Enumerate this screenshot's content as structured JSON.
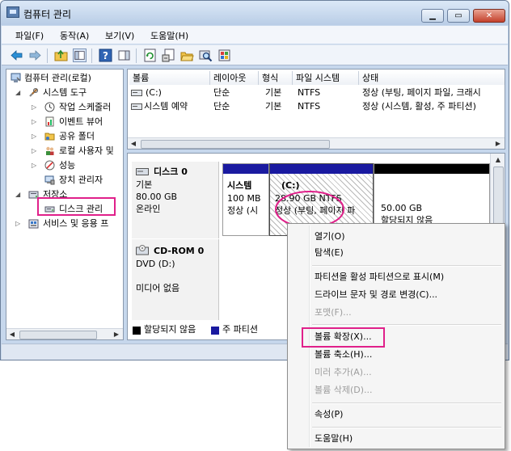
{
  "window": {
    "title": "컴퓨터 관리"
  },
  "menu": [
    "파일(F)",
    "동작(A)",
    "보기(V)",
    "도움말(H)"
  ],
  "colors": {
    "accent_highlight": "#e0208a",
    "primary_partition": "#1a1aa0",
    "unallocated": "#000000"
  },
  "tree": [
    {
      "label": "컴퓨터 관리(로컬)",
      "icon": "computer-management-icon"
    },
    {
      "label": "시스템 도구",
      "icon": "tools-icon"
    },
    {
      "label": "작업 스케줄러",
      "icon": "clock-icon"
    },
    {
      "label": "이벤트 뷰어",
      "icon": "event-viewer-icon"
    },
    {
      "label": "공유 폴더",
      "icon": "shared-folder-icon"
    },
    {
      "label": "로컬 사용자 및",
      "icon": "users-icon"
    },
    {
      "label": "성능",
      "icon": "performance-icon"
    },
    {
      "label": "장치 관리자",
      "icon": "device-manager-icon"
    },
    {
      "label": "저장소",
      "icon": "storage-icon"
    },
    {
      "label": "디스크 관리",
      "icon": "disk-icon"
    },
    {
      "label": "서비스 및 응용 프",
      "icon": "services-icon"
    }
  ],
  "volume_list": {
    "headers": [
      "볼륨",
      "레이아웃",
      "형식",
      "파일 시스템",
      "상태"
    ],
    "rows": [
      [
        "(C:)",
        "단순",
        "기본",
        "NTFS",
        "정상 (부팅, 페이지 파일, 크래시"
      ],
      [
        "시스템 예약",
        "단순",
        "기본",
        "NTFS",
        "정상 (시스템, 활성, 주 파티션)"
      ]
    ]
  },
  "disks": {
    "disk0": {
      "name": "디스크 0",
      "type": "기본",
      "size": "80.00 GB",
      "status": "온라인",
      "partitions": [
        {
          "name": "시스템 ",
          "size": "100 MB",
          "status": "정상 (시"
        },
        {
          "name": "(C:)",
          "size": "28.90 GB NTFS",
          "status": "정상 (부팅, 페이지 파"
        },
        {
          "size": "50.00 GB",
          "status": "할당되지 않음"
        }
      ]
    },
    "cdrom0": {
      "name": "CD-ROM 0",
      "drive": "DVD (D:)",
      "media": "미디어 없음"
    }
  },
  "legend": [
    "할당되지 않음",
    "주 파티션"
  ],
  "context_menu": {
    "items": [
      {
        "label": "열기(O)",
        "enabled": true
      },
      {
        "label": "탐색(E)",
        "enabled": true
      },
      {
        "label": "파티션을 활성 파티션으로 표시(M)",
        "enabled": true
      },
      {
        "label": "드라이브 문자 및 경로 변경(C)...",
        "enabled": true
      },
      {
        "label": "포맷(F)...",
        "enabled": false
      },
      {
        "label": "볼륨 확장(X)...",
        "enabled": true
      },
      {
        "label": "볼륨 축소(H)...",
        "enabled": true
      },
      {
        "label": "미러 추가(A)...",
        "enabled": false
      },
      {
        "label": "볼륨 삭제(D)...",
        "enabled": false
      },
      {
        "label": "속성(P)",
        "enabled": true
      },
      {
        "label": "도움말(H)",
        "enabled": true
      }
    ]
  }
}
